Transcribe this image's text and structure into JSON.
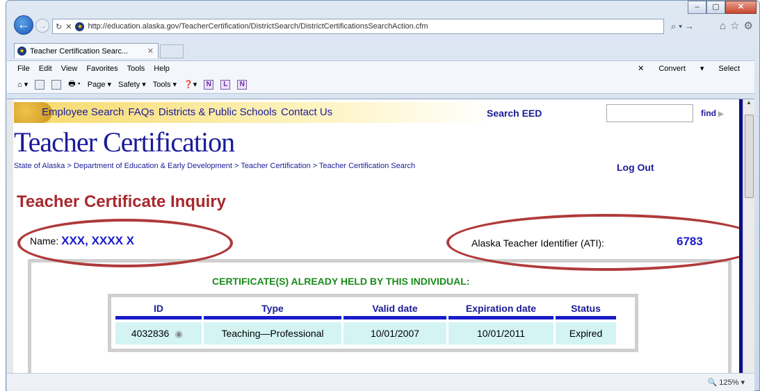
{
  "browser": {
    "url": "http://education.alaska.gov/TeacherCertification/DistrictSearch/DistrictCertificationsSearchAction.cfm",
    "tab_title": "Teacher Certification Searc...",
    "menu": [
      "File",
      "Edit",
      "View",
      "Favorites",
      "Tools",
      "Help"
    ],
    "menu_right": [
      "Convert",
      "Select"
    ],
    "commands": [
      "Page ▾",
      "Safety ▾",
      "Tools ▾"
    ],
    "zoom": "125%"
  },
  "site": {
    "nav": [
      "Employee Search",
      "FAQs",
      "Districts & Public Schools",
      "Contact Us"
    ],
    "search_label": "Search EED",
    "find_label": "find",
    "title": "Teacher Certification",
    "breadcrumb": "State of Alaska > Department of Education & Early Development > Teacher Certification > Teacher Certification Search",
    "logout": "Log Out"
  },
  "inquiry": {
    "title": "Teacher Certificate Inquiry",
    "name_label": "Name:",
    "name_value": "XXX, XXXX X",
    "ati_label": "Alaska Teacher Identifier (ATI):",
    "ati_value": "6783"
  },
  "certificates": {
    "heading": "CERTIFICATE(S) ALREADY HELD BY THIS INDIVIDUAL:",
    "columns": [
      "ID",
      "Type",
      "Valid date",
      "Expiration date",
      "Status"
    ],
    "rows": [
      {
        "id": "4032836",
        "type": "Teaching—Professional",
        "valid": "10/01/2007",
        "expiration": "10/01/2011",
        "status": "Expired"
      }
    ]
  }
}
